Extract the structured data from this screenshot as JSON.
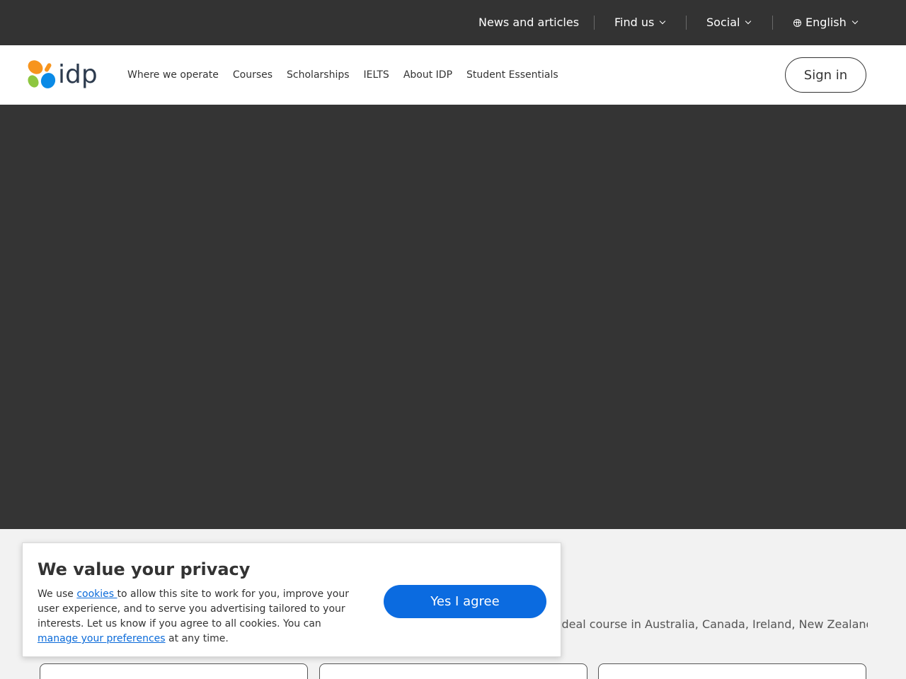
{
  "topbar": {
    "news": "News and articles",
    "find_us": "Find us",
    "social": "Social",
    "language": "English"
  },
  "header": {
    "logo_text": "idp",
    "nav": [
      "Where we operate",
      "Courses",
      "Scholarships",
      "IELTS",
      "About IDP",
      "Student Essentials"
    ],
    "signin": "Sign in"
  },
  "below": {
    "text": "ideal course in Australia, Canada, Ireland, New Zealand,"
  },
  "cookie": {
    "title": "We value your privacy",
    "text_before": "We use ",
    "cookies_link": "cookies ",
    "text_middle": "to allow this site to work for you, improve your user experience, and to serve you advertising tailored to your interests. Let us know if you agree to all cookies. You can ",
    "manage_link": "manage your preferences",
    "text_after": " at any time.",
    "agree_button": "Yes I agree"
  },
  "colors": {
    "topbar_bg": "#333333",
    "accent_blue": "#0b6be0",
    "logo_orange": "#f7941d",
    "logo_green": "#8dc63f",
    "logo_blue": "#0a8ae6",
    "logo_text": "#2d3b4e"
  }
}
